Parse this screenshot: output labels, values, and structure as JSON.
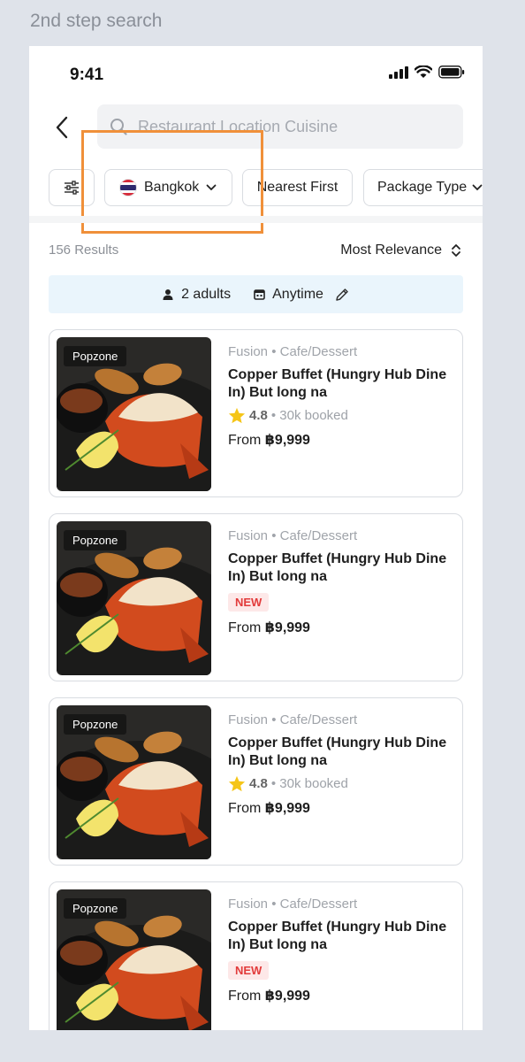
{
  "frame_label": "2nd step search",
  "status": {
    "time": "9:41"
  },
  "search": {
    "placeholder": "Restaurant Location Cuisine"
  },
  "filters": {
    "city": "Bangkok",
    "nearest": "Nearest First",
    "package": "Package Type"
  },
  "results": {
    "count_text": "156 Results",
    "sort_label": "Most Relevance"
  },
  "guests": {
    "adults": "2 adults",
    "time": "Anytime"
  },
  "colors": {
    "highlight": "#f0903a",
    "new_badge": "#e23b3b",
    "star": "#f5c518",
    "guest_bg": "#eaf5fc"
  },
  "cards": [
    {
      "badge": "Popzone",
      "category": "Fusion • Cafe/Dessert",
      "name": "Copper Buffet (Hungry Hub Dine In) But long na",
      "rating": "4.8",
      "booked": "• 30k booked",
      "price_prefix": "From ",
      "price": "฿9,999"
    },
    {
      "badge": "Popzone",
      "category": "Fusion • Cafe/Dessert",
      "name": "Copper Buffet (Hungry Hub Dine In) But long na",
      "tag": "NEW",
      "price_prefix": "From ",
      "price": "฿9,999"
    },
    {
      "badge": "Popzone",
      "category": "Fusion • Cafe/Dessert",
      "name": "Copper Buffet (Hungry Hub Dine In) But long na",
      "rating": "4.8",
      "booked": "• 30k booked",
      "price_prefix": "From ",
      "price": "฿9,999"
    },
    {
      "badge": "Popzone",
      "category": "Fusion • Cafe/Dessert",
      "name": "Copper Buffet (Hungry Hub Dine In) But long na",
      "tag": "NEW",
      "price_prefix": "From ",
      "price": "฿9,999"
    }
  ]
}
